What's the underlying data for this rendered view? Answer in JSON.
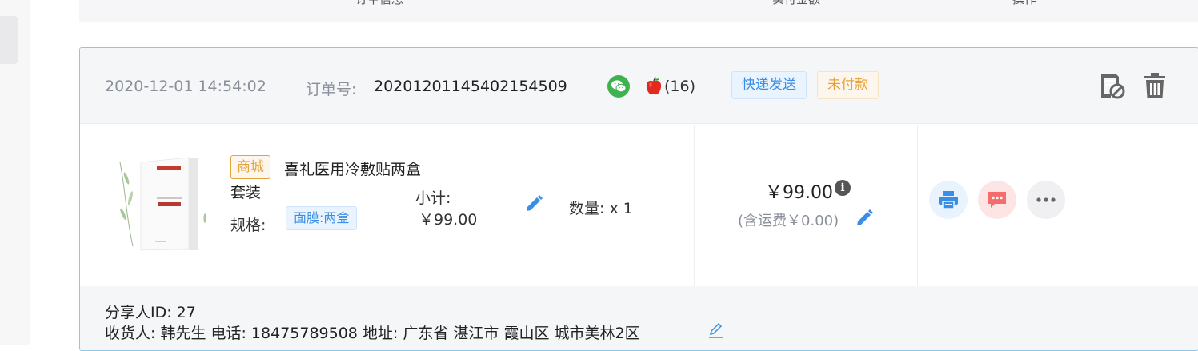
{
  "table_header": {
    "col_product": "订单信息",
    "col_amount": "实付金额",
    "col_actions": "操作"
  },
  "order": {
    "datetime": "2020-12-01 14:54:02",
    "order_no_label": "订单号:",
    "order_no": "20201201145402154509",
    "apple_count": "(16)",
    "tag_express": "快递发送",
    "tag_unpaid": "未付款",
    "product": {
      "source_tag": "商城",
      "name": "喜礼医用冷敷贴两盒套装",
      "spec_label": "规格:",
      "spec_value": "面膜:两盒",
      "subtotal_label": "小计:",
      "subtotal_value": "￥99.00",
      "quantity": "数量:  x 1"
    },
    "amount": {
      "total": "￥99.00",
      "shipping_note": "(含运费￥0.00)"
    },
    "footer": {
      "sharer": "分享人ID:  27",
      "receiver": "收货人: 韩先生  电话:  18475789508  地址:  广东省 湛江市 霞山区 城市美林2区"
    }
  },
  "icons": {
    "wechat": "wechat-icon",
    "apple": "apple-icon",
    "cancel_order": "cancel-order-icon",
    "delete": "trash-icon",
    "edit": "pencil-icon",
    "info": "info-icon",
    "print": "printer-icon",
    "message": "message-icon",
    "more": "more-icon"
  },
  "colors": {
    "card_border": "#8ec6ea",
    "blue_accent": "#3a8ee6",
    "orange_accent": "#e6a23c",
    "wechat_green": "#3fb24f",
    "message_red": "#f56c6c"
  }
}
